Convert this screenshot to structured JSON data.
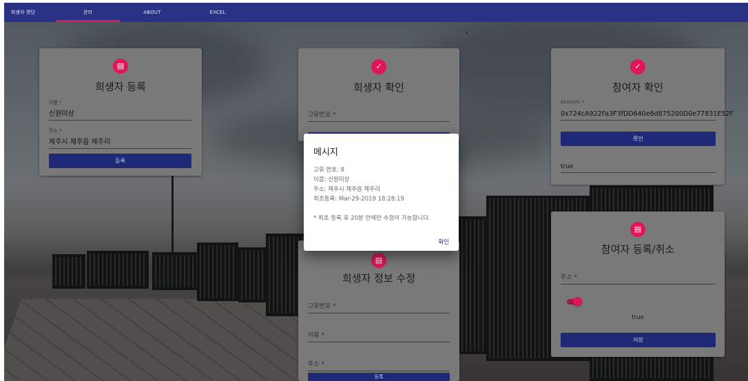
{
  "nav": {
    "items": [
      {
        "label": "희생자 명단"
      },
      {
        "label": "관리"
      },
      {
        "label": "ABOUT"
      },
      {
        "label": "EXCEL"
      }
    ],
    "active_index": 1,
    "bar_color": "#2a3285",
    "indicator_color": "#e2175a"
  },
  "cards": {
    "victim_register": {
      "icon": "id-card-icon",
      "title": "희생자 등록",
      "name_label": "이름 *",
      "name_value": "신원미상",
      "address_label": "주소 *",
      "address_value": "제주시 제주읍 제주리",
      "button": "등록"
    },
    "victim_check": {
      "icon": "check-circle-icon",
      "title": "희생자 확인",
      "id_placeholder": "고유번호 *"
    },
    "participant_check": {
      "icon": "check-circle-icon",
      "title": "참여자 확인",
      "account_label": "Account *",
      "account_value": "0x724cA922Fa3F3fDD640e6d875200D0e77831E52F",
      "button": "확인",
      "result": "true"
    },
    "participant_register": {
      "icon": "id-card-icon",
      "title": "참여자 등록/취소",
      "address_placeholder": "주소 *",
      "toggle_state": "true",
      "button": "저장"
    },
    "victim_edit": {
      "icon": "id-card-icon",
      "title": "희생자 정보 수정",
      "id_placeholder": "고유번호 *",
      "name_placeholder": "이름 *",
      "address_placeholder": "주소 *",
      "button": "등록"
    }
  },
  "dialog": {
    "title": "메시지",
    "lines": [
      "고유 번호: 8",
      "이름: 신원미상",
      "주소: 제주시 제주읍 제주리",
      "최초등록: Mar-29-2019 18:28:19"
    ],
    "note": "* 최초 등록 후 20분 안에만 수정이 가능합니다.",
    "ok": "확인"
  },
  "colors": {
    "accent": "#e0165a",
    "primary_button": "#1e2a78"
  }
}
